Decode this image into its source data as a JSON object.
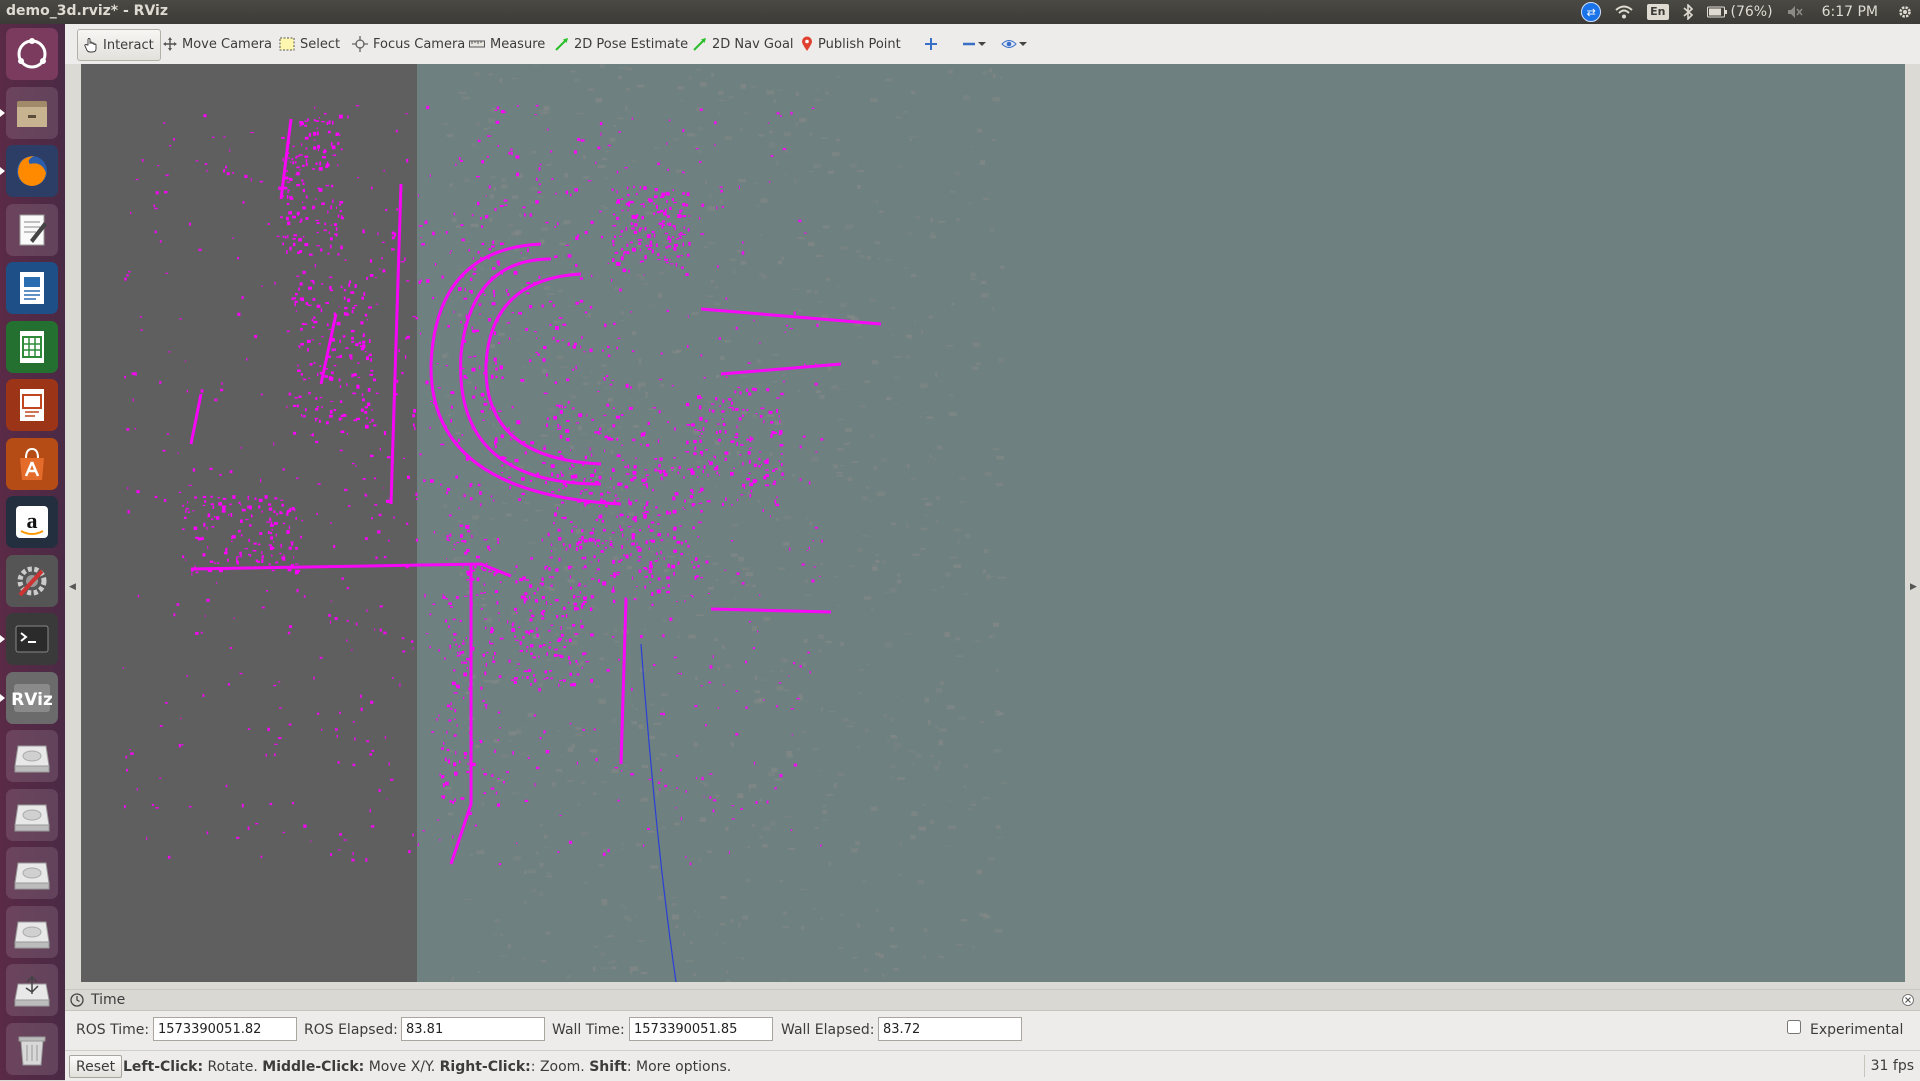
{
  "window": {
    "title": "demo_3d.rviz* - RViz"
  },
  "tray": {
    "keyboard": "En",
    "battery": "(76%)",
    "clock": "6:17 PM"
  },
  "launcher": {
    "items": [
      {
        "name": "dash-icon",
        "color": "#dd4814"
      },
      {
        "name": "files-icon",
        "color": "#7a6a55"
      },
      {
        "name": "firefox-icon",
        "color": "#e66000"
      },
      {
        "name": "text-editor-icon",
        "color": "#e8e8e8"
      },
      {
        "name": "writer-icon",
        "color": "#2a6db0"
      },
      {
        "name": "calc-icon",
        "color": "#2f8b3a"
      },
      {
        "name": "impress-icon",
        "color": "#c0461e"
      },
      {
        "name": "software-center-icon",
        "color": "#e46b2a"
      },
      {
        "name": "amazon-icon",
        "color": "#ffffff"
      },
      {
        "name": "system-settings-icon",
        "color": "#c33"
      },
      {
        "name": "terminal-icon",
        "color": "#2b2b2b"
      },
      {
        "name": "rviz-icon",
        "color": "#9a9a9a"
      },
      {
        "name": "drive-icon",
        "color": "#cfcfcf"
      },
      {
        "name": "drive-icon",
        "color": "#cfcfcf"
      },
      {
        "name": "drive-icon",
        "color": "#cfcfcf"
      },
      {
        "name": "drive-icon",
        "color": "#cfcfcf"
      },
      {
        "name": "usb-drive-icon",
        "color": "#cfcfcf"
      },
      {
        "name": "trash-icon",
        "color": "#cfcfcf"
      }
    ]
  },
  "toolbar": {
    "interact": "Interact",
    "move_camera": "Move Camera",
    "select": "Select",
    "focus_camera": "Focus Camera",
    "measure": "Measure",
    "pose_estimate": "2D Pose Estimate",
    "nav_goal": "2D Nav Goal",
    "publish_point": "Publish Point"
  },
  "time_panel": {
    "title": "Time",
    "ros_time_label": "ROS Time:",
    "ros_time_value": "1573390051.82",
    "ros_elapsed_label": "ROS Elapsed:",
    "ros_elapsed_value": "83.81",
    "wall_time_label": "Wall Time:",
    "wall_time_value": "1573390051.85",
    "wall_elapsed_label": "Wall Elapsed:",
    "wall_elapsed_value": "83.72",
    "experimental_label": "Experimental",
    "experimental_checked": false
  },
  "statusbar": {
    "reset_label": "Reset",
    "help": [
      {
        "key": "Left-Click:",
        "text": " Rotate. "
      },
      {
        "key": "Middle-Click:",
        "text": " Move X/Y. "
      },
      {
        "key": "Right-Click:",
        "text": ": Zoom. "
      },
      {
        "key": "Shift",
        "text": ": More options."
      }
    ],
    "fps": "31 fps"
  },
  "colors": {
    "viewport_bg": "#6e807f",
    "map_dark": "#5f5f5f",
    "point_cloud": "#ff00ff",
    "accent_blue": "#1a73e8"
  }
}
